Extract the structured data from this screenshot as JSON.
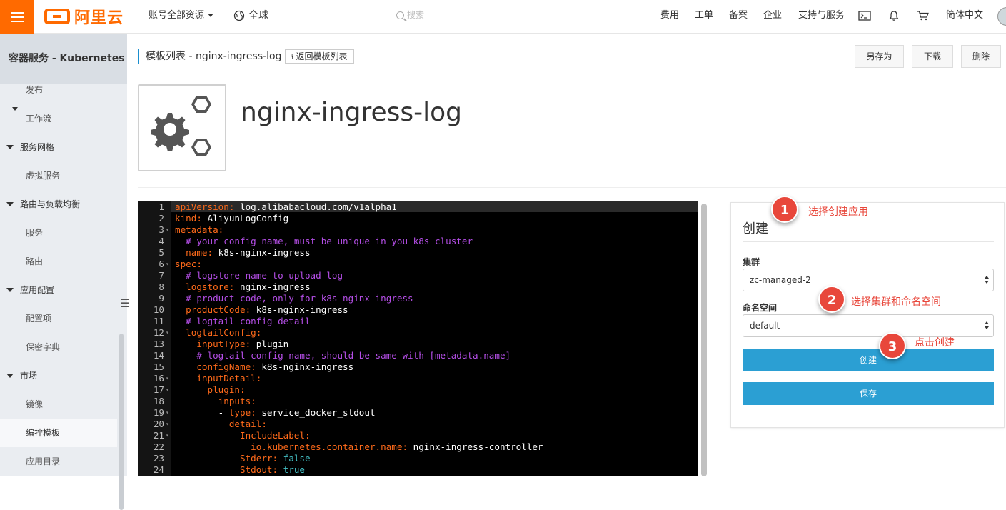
{
  "header": {
    "logo_text": "阿里云",
    "resource_menu": "账号全部资源",
    "region": "全球",
    "search_placeholder": "搜索",
    "links": [
      "费用",
      "工单",
      "备案",
      "企业",
      "支持与服务"
    ],
    "language": "简体中文"
  },
  "sidebar": {
    "title": "容器服务 - Kubernetes",
    "items": [
      {
        "label": "发布",
        "type": "item"
      },
      {
        "label": "工作流",
        "type": "item"
      },
      {
        "label": "服务网格",
        "type": "group"
      },
      {
        "label": "虚拟服务",
        "type": "item"
      },
      {
        "label": "路由与负载均衡",
        "type": "group"
      },
      {
        "label": "服务",
        "type": "item"
      },
      {
        "label": "路由",
        "type": "item"
      },
      {
        "label": "应用配置",
        "type": "group"
      },
      {
        "label": "配置项",
        "type": "item"
      },
      {
        "label": "保密字典",
        "type": "item"
      },
      {
        "label": "市场",
        "type": "group"
      },
      {
        "label": "镜像",
        "type": "item"
      },
      {
        "label": "编排模板",
        "type": "item",
        "active": true
      },
      {
        "label": "应用目录",
        "type": "item"
      }
    ]
  },
  "page": {
    "breadcrumb": "模板列表 - nginx-ingress-log",
    "back_button": "返回模板列表",
    "save_as_button": "另存为",
    "download_button": "下载",
    "delete_button": "删除",
    "template_name": "nginx-ingress-log"
  },
  "editor": {
    "lines": [
      {
        "n": "1",
        "fold": false,
        "parts": [
          [
            "k",
            "apiVersion: "
          ],
          [
            "v",
            "log.alibabacloud.com/v1alpha1"
          ]
        ]
      },
      {
        "n": "2",
        "fold": false,
        "parts": [
          [
            "k",
            "kind: "
          ],
          [
            "v",
            "AliyunLogConfig"
          ]
        ]
      },
      {
        "n": "3",
        "fold": true,
        "parts": [
          [
            "k",
            "metadata:"
          ]
        ]
      },
      {
        "n": "4",
        "fold": false,
        "parts": [
          [
            "v",
            "  "
          ],
          [
            "c",
            "# your config name, must be unique in you k8s cluster"
          ]
        ]
      },
      {
        "n": "5",
        "fold": false,
        "parts": [
          [
            "k",
            "  name: "
          ],
          [
            "v",
            "k8s-nginx-ingress"
          ]
        ]
      },
      {
        "n": "6",
        "fold": true,
        "parts": [
          [
            "k",
            "spec:"
          ]
        ]
      },
      {
        "n": "7",
        "fold": false,
        "parts": [
          [
            "v",
            "  "
          ],
          [
            "c",
            "# logstore name to upload log"
          ]
        ]
      },
      {
        "n": "8",
        "fold": false,
        "parts": [
          [
            "k",
            "  logstore: "
          ],
          [
            "v",
            "nginx-ingress"
          ]
        ]
      },
      {
        "n": "9",
        "fold": false,
        "parts": [
          [
            "v",
            "  "
          ],
          [
            "c",
            "# product code, only for k8s nginx ingress"
          ]
        ]
      },
      {
        "n": "10",
        "fold": false,
        "parts": [
          [
            "k",
            "  productCode: "
          ],
          [
            "v",
            "k8s-nginx-ingress"
          ]
        ]
      },
      {
        "n": "11",
        "fold": false,
        "parts": [
          [
            "v",
            "  "
          ],
          [
            "c",
            "# logtail config detail"
          ]
        ]
      },
      {
        "n": "12",
        "fold": true,
        "parts": [
          [
            "k",
            "  logtailConfig:"
          ]
        ]
      },
      {
        "n": "13",
        "fold": false,
        "parts": [
          [
            "k",
            "    inputType: "
          ],
          [
            "v",
            "plugin"
          ]
        ]
      },
      {
        "n": "14",
        "fold": false,
        "parts": [
          [
            "v",
            "    "
          ],
          [
            "c",
            "# logtail config name, should be same with [metadata.name]"
          ]
        ]
      },
      {
        "n": "15",
        "fold": false,
        "parts": [
          [
            "k",
            "    configName: "
          ],
          [
            "v",
            "k8s-nginx-ingress"
          ]
        ]
      },
      {
        "n": "16",
        "fold": true,
        "parts": [
          [
            "k",
            "    inputDetail:"
          ]
        ]
      },
      {
        "n": "17",
        "fold": true,
        "parts": [
          [
            "k",
            "      plugin:"
          ]
        ]
      },
      {
        "n": "18",
        "fold": false,
        "parts": [
          [
            "k",
            "        inputs:"
          ]
        ]
      },
      {
        "n": "19",
        "fold": true,
        "parts": [
          [
            "v",
            "        - "
          ],
          [
            "k",
            "type: "
          ],
          [
            "v",
            "service_docker_stdout"
          ]
        ]
      },
      {
        "n": "20",
        "fold": true,
        "parts": [
          [
            "k",
            "          detail:"
          ]
        ]
      },
      {
        "n": "21",
        "fold": true,
        "parts": [
          [
            "k",
            "            IncludeLabel:"
          ]
        ]
      },
      {
        "n": "22",
        "fold": false,
        "parts": [
          [
            "k",
            "              io.kubernetes.container.name: "
          ],
          [
            "v",
            "nginx-ingress-controller"
          ]
        ]
      },
      {
        "n": "23",
        "fold": false,
        "parts": [
          [
            "k",
            "            Stderr: "
          ],
          [
            "b",
            "false"
          ]
        ]
      },
      {
        "n": "24",
        "fold": false,
        "parts": [
          [
            "k",
            "            Stdout: "
          ],
          [
            "b",
            "true"
          ]
        ]
      }
    ]
  },
  "create_panel": {
    "title": "创建",
    "cluster_label": "集群",
    "cluster_value": "zc-managed-2",
    "namespace_label": "命名空间",
    "namespace_value": "default",
    "create_button": "创建",
    "save_button": "保存"
  },
  "annotations": [
    {
      "num": "1",
      "text": "选择创建应用"
    },
    {
      "num": "2",
      "text": "选择集群和命名空间"
    },
    {
      "num": "3",
      "text": "点击创建"
    }
  ],
  "colors": {
    "brand": "#ff6a00",
    "primary_button": "#2b9fd3",
    "annotation": "#e8473b",
    "yaml_key": "#ff6a1a",
    "yaml_comment": "#b44ee6"
  }
}
